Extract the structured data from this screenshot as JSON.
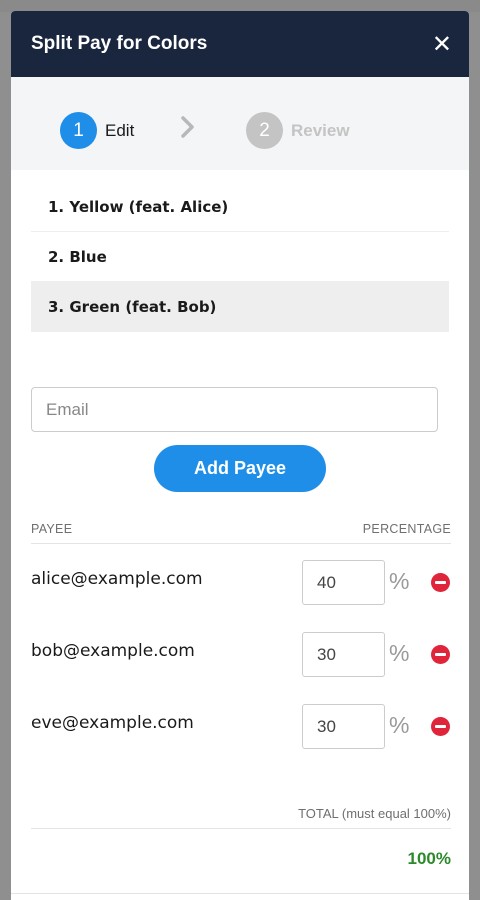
{
  "modal": {
    "title": "Split Pay for Colors",
    "close_label": "✕"
  },
  "stepper": {
    "steps": [
      {
        "number": "1",
        "label": "Edit",
        "state": "active"
      },
      {
        "number": "2",
        "label": "Review",
        "state": "inactive"
      }
    ],
    "separator_icon": "chevron-right-icon"
  },
  "tracks": [
    {
      "label": "1. Yellow (feat. Alice)",
      "selected": false
    },
    {
      "label": "2. Blue",
      "selected": false
    },
    {
      "label": "3. Green (feat. Bob)",
      "selected": true
    }
  ],
  "email_input": {
    "placeholder": "Email",
    "value": ""
  },
  "add_payee_label": "Add Payee",
  "table": {
    "headers": {
      "payee": "PAYEE",
      "percentage": "PERCENTAGE"
    },
    "rows": [
      {
        "email": "alice@example.com",
        "percentage": "40",
        "unit": "%"
      },
      {
        "email": "bob@example.com",
        "percentage": "30",
        "unit": "%"
      },
      {
        "email": "eve@example.com",
        "percentage": "30",
        "unit": "%"
      }
    ]
  },
  "total": {
    "label": "TOTAL (must equal 100%)",
    "value": "100%"
  },
  "colors": {
    "header_bg": "#19263e",
    "accent": "#1e8ee8",
    "remove": "#e0243a",
    "total_ok": "#2b8a2b"
  }
}
